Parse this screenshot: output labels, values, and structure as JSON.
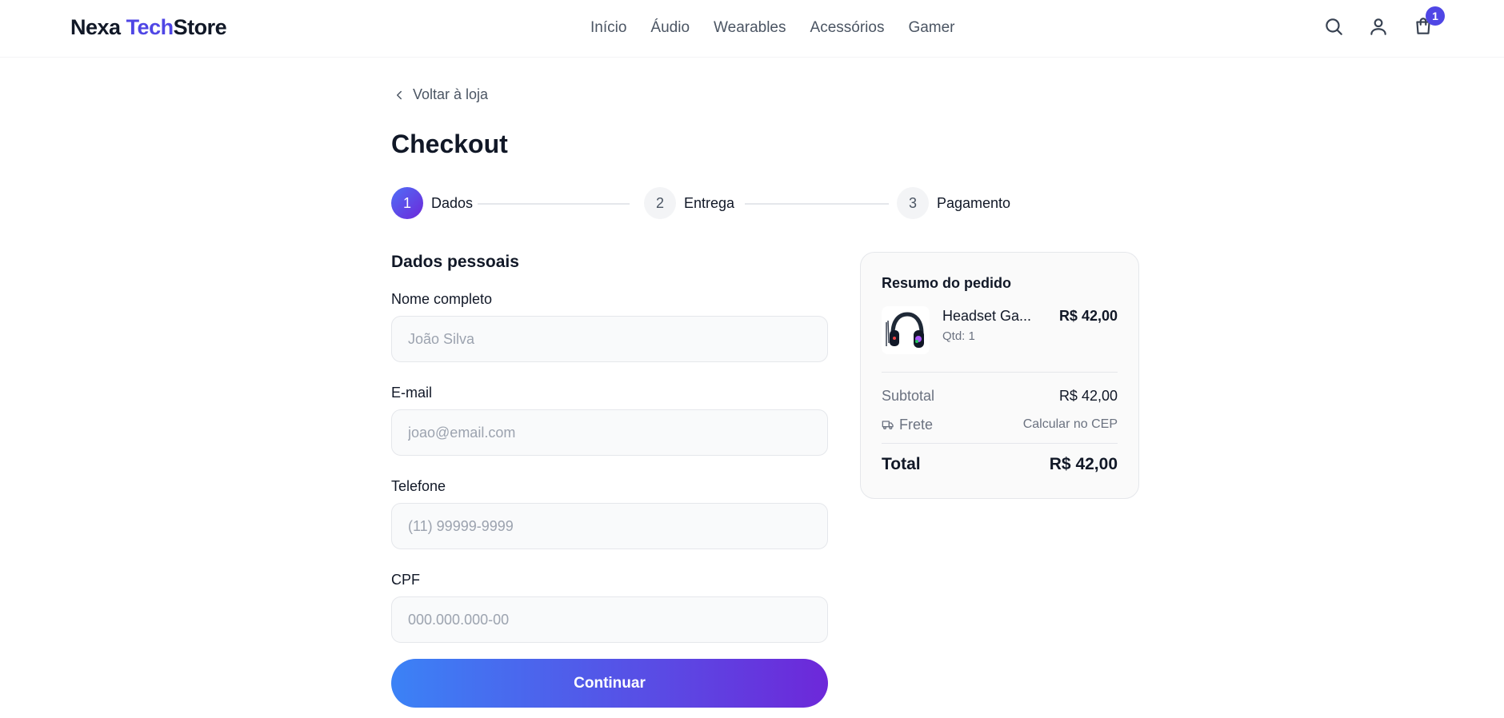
{
  "header": {
    "logo": {
      "part1": "Nexa ",
      "part2": "Tech",
      "part3": "Store"
    },
    "nav": [
      "Início",
      "Áudio",
      "Wearables",
      "Acessórios",
      "Gamer"
    ],
    "cart_count": "1"
  },
  "back_link": "Voltar à loja",
  "page_title": "Checkout",
  "steps": [
    {
      "number": "1",
      "label": "Dados",
      "state": "active"
    },
    {
      "number": "2",
      "label": "Entrega",
      "state": "inactive"
    },
    {
      "number": "3",
      "label": "Pagamento",
      "state": "inactive"
    }
  ],
  "form": {
    "title": "Dados pessoais",
    "fields": [
      {
        "label": "Nome completo",
        "placeholder": "João Silva",
        "value": ""
      },
      {
        "label": "E-mail",
        "placeholder": "joao@email.com",
        "value": ""
      },
      {
        "label": "Telefone",
        "placeholder": "(11) 99999-9999",
        "value": ""
      },
      {
        "label": "CPF",
        "placeholder": "000.000.000-00",
        "value": ""
      }
    ],
    "submit_label": "Continuar"
  },
  "summary": {
    "title": "Resumo do pedido",
    "item": {
      "name": "Headset Ga...",
      "qty": "Qtd: 1",
      "price": "R$ 42,00"
    },
    "subtotal_label": "Subtotal",
    "subtotal_value": "R$ 42,00",
    "shipping_label": "Frete",
    "shipping_value": "Calcular no CEP",
    "total_label": "Total",
    "total_value": "R$ 42,00"
  },
  "colors": {
    "accent": "#4f46e5",
    "button_gradient_start": "#3b82f6",
    "button_gradient_end": "#6d28d9"
  },
  "icons": [
    "search-icon",
    "user-icon",
    "cart-icon",
    "chevron-left-icon",
    "truck-icon",
    "headset-icon"
  ]
}
